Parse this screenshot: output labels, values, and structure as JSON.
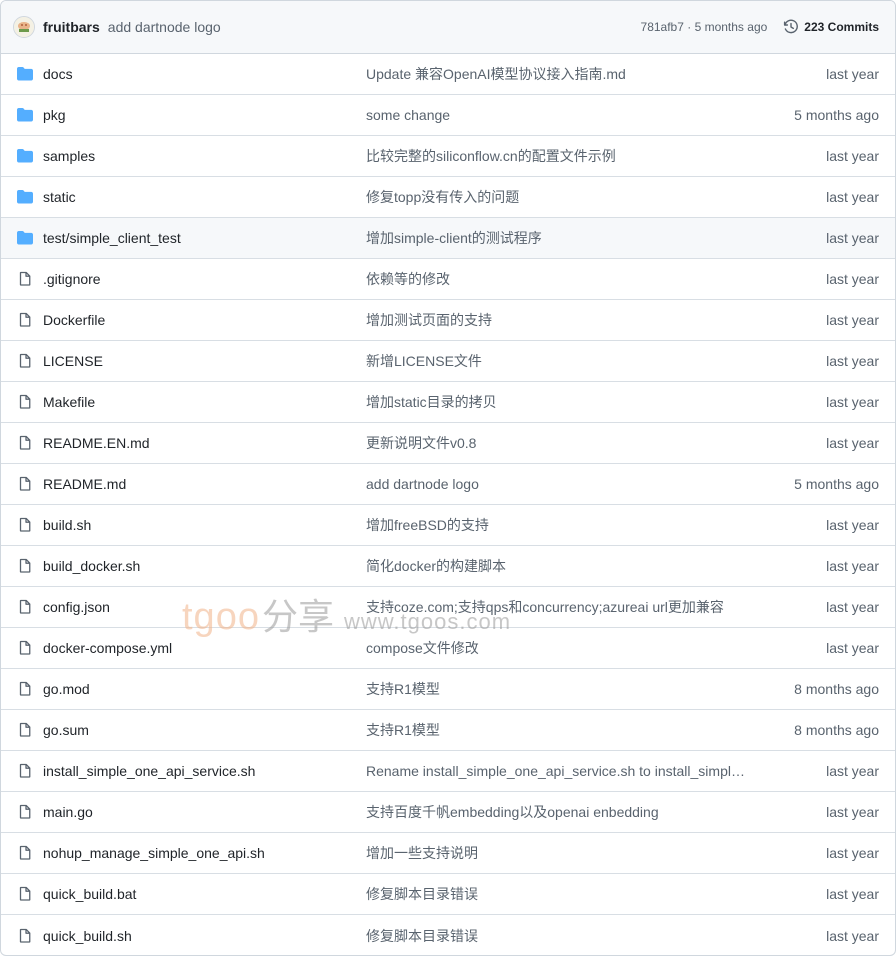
{
  "latest_commit": {
    "author": "fruitbars",
    "message": "add dartnode logo",
    "meta": "781afb7 · 5 months ago",
    "history_label": "223 Commits"
  },
  "watermark": {
    "brand": "tgoo",
    "share": "分享",
    "url": "www.tgoos.com"
  },
  "files": [
    {
      "type": "folder",
      "name": "docs",
      "message": "Update 兼容OpenAI模型协议接入指南.md",
      "age": "last year"
    },
    {
      "type": "folder",
      "name": "pkg",
      "message": "some change",
      "age": "5 months ago"
    },
    {
      "type": "folder",
      "name": "samples",
      "message": "比较完整的siliconflow.cn的配置文件示例",
      "age": "last year"
    },
    {
      "type": "folder",
      "name": "static",
      "message": "修复topp没有传入的问题",
      "age": "last year"
    },
    {
      "type": "folder",
      "name": "test/simple_client_test",
      "message": "增加simple-client的测试程序",
      "age": "last year"
    },
    {
      "type": "file",
      "name": ".gitignore",
      "message": "依赖等的修改",
      "age": "last year"
    },
    {
      "type": "file",
      "name": "Dockerfile",
      "message": "增加测试页面的支持",
      "age": "last year"
    },
    {
      "type": "file",
      "name": "LICENSE",
      "message": "新增LICENSE文件",
      "age": "last year"
    },
    {
      "type": "file",
      "name": "Makefile",
      "message": "增加static目录的拷贝",
      "age": "last year"
    },
    {
      "type": "file",
      "name": "README.EN.md",
      "message": "更新说明文件v0.8",
      "age": "last year"
    },
    {
      "type": "file",
      "name": "README.md",
      "message": "add dartnode logo",
      "age": "5 months ago"
    },
    {
      "type": "file",
      "name": "build.sh",
      "message": "增加freeBSD的支持",
      "age": "last year"
    },
    {
      "type": "file",
      "name": "build_docker.sh",
      "message": "简化docker的构建脚本",
      "age": "last year"
    },
    {
      "type": "file",
      "name": "config.json",
      "message": "支持coze.com;支持qps和concurrency;azureai url更加兼容",
      "age": "last year"
    },
    {
      "type": "file",
      "name": "docker-compose.yml",
      "message": "compose文件修改",
      "age": "last year"
    },
    {
      "type": "file",
      "name": "go.mod",
      "message": "支持R1模型",
      "age": "8 months ago"
    },
    {
      "type": "file",
      "name": "go.sum",
      "message": "支持R1模型",
      "age": "8 months ago"
    },
    {
      "type": "file",
      "name": "install_simple_one_api_service.sh",
      "message": "Rename install_simple_one_api_service.sh to install_simple_o…",
      "age": "last year"
    },
    {
      "type": "file",
      "name": "main.go",
      "message": "支持百度千帆embedding以及openai enbedding",
      "age": "last year"
    },
    {
      "type": "file",
      "name": "nohup_manage_simple_one_api.sh",
      "message": "增加一些支持说明",
      "age": "last year"
    },
    {
      "type": "file",
      "name": "quick_build.bat",
      "message": "修复脚本目录错误",
      "age": "last year"
    },
    {
      "type": "file",
      "name": "quick_build.sh",
      "message": "修复脚本目录错误",
      "age": "last year"
    }
  ]
}
